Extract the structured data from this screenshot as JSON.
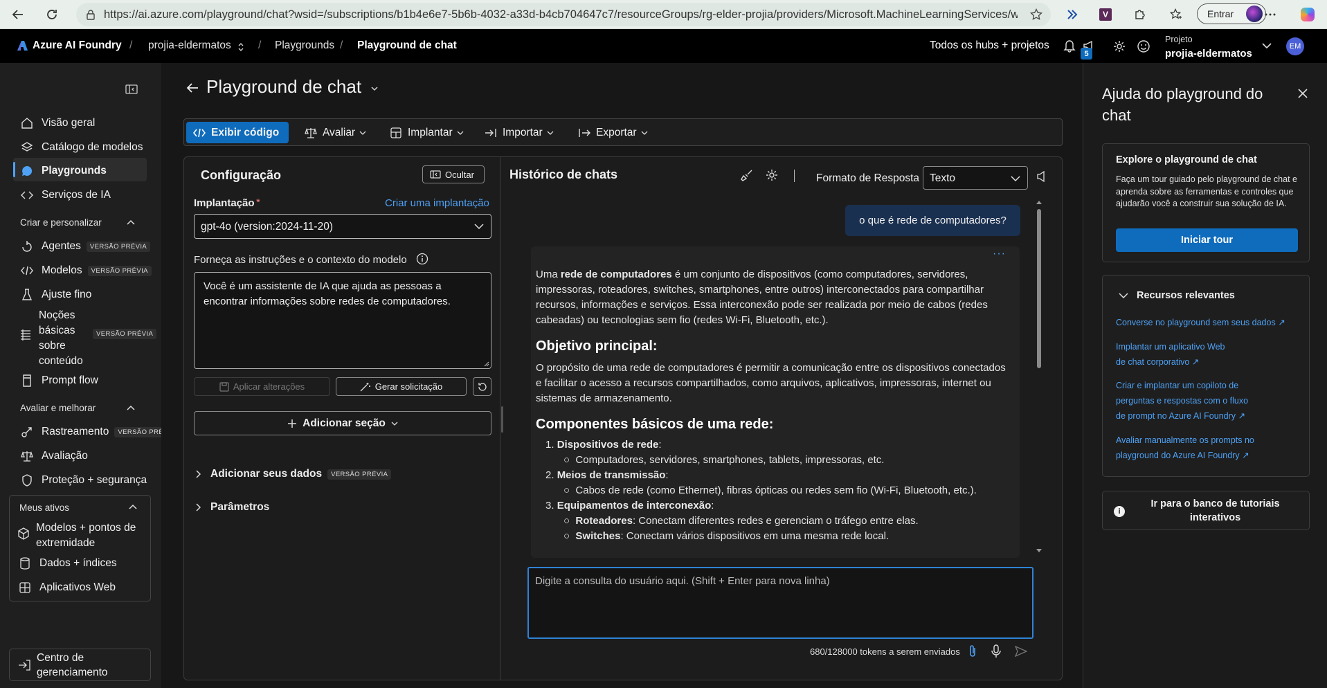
{
  "browser": {
    "url": "https://ai.azure.com/playground/chat?wsid=/subscriptions/b1b4e6e7-5b6b-4032-a33d-b4cb704647c7/resourceGroups/rg-elder-projia/providers/Microsoft.MachineLearningServices/workspa...",
    "signin_label": "Entrar"
  },
  "topbar": {
    "brand": "Azure AI Foundry",
    "project_crumb": "projia-eldermatos",
    "crumb_playgrounds": "Playgrounds",
    "crumb_current": "Playground de chat",
    "hubs_link": "Todos os hubs + projetos",
    "notification_count": "5",
    "project_label": "Projeto",
    "project_name": "projia-eldermatos",
    "avatar_initials": "EM"
  },
  "sidebar": {
    "items_top": [
      {
        "label": "Visão geral",
        "icon": "home-icon"
      },
      {
        "label": "Catálogo de modelos",
        "icon": "catalog-icon"
      },
      {
        "label": "Playgrounds",
        "icon": "chat-icon",
        "active": true
      },
      {
        "label": "Serviços de IA",
        "icon": "ai-services-icon"
      }
    ],
    "group_create": "Criar e personalizar",
    "items_create": [
      {
        "label": "Agentes",
        "badge": "VERSÃO PRÉVIA"
      },
      {
        "label": "Modelos",
        "badge": "VERSÃO PRÉVIA"
      },
      {
        "label": "Ajuste fino"
      },
      {
        "label": "Noções básicas sobre conteúdo",
        "badge": "VERSÃO PRÉVIA"
      },
      {
        "label": "Prompt flow"
      }
    ],
    "group_evaluate": "Avaliar e melhorar",
    "items_evaluate": [
      {
        "label": "Rastreamento",
        "badge": "VERSÃO PRÉ"
      },
      {
        "label": "Avaliação"
      },
      {
        "label": "Proteção + segurança"
      }
    ],
    "group_assets": "Meus ativos",
    "items_assets": [
      {
        "label": "Modelos + pontos de extremidade"
      },
      {
        "label": "Dados + índices"
      },
      {
        "label": "Aplicativos Web"
      }
    ],
    "management": "Centro de gerenciamento"
  },
  "page": {
    "title": "Playground de chat"
  },
  "toolbar": {
    "view_code": "Exibir código",
    "evaluate": "Avaliar",
    "deploy": "Implantar",
    "import": "Importar",
    "export": "Exportar"
  },
  "config": {
    "title": "Configuração",
    "hide": "Ocultar",
    "deployment_label": "Implantação",
    "required_mark": "*",
    "create_deployment": "Criar uma implantação",
    "deployment_value": "gpt-4o (version:2024-11-20)",
    "instructions_label": "Forneça as instruções e o contexto do modelo",
    "system_message": "Você é um assistente de IA que ajuda as pessoas a encontrar informações sobre redes de computadores.",
    "apply_changes": "Aplicar alterações",
    "generate_prompt": "Gerar solicitação",
    "add_section": "Adicionar seção",
    "add_data": "Adicionar seus dados",
    "add_data_badge": "VERSÃO PRÉVIA",
    "parameters": "Parâmetros"
  },
  "chat": {
    "title": "Histórico de chats",
    "response_format_label": "Formato de Resposta",
    "response_format_value": "Texto",
    "user_message": "o que é rede de computadores?",
    "answer_intro_before": "Uma ",
    "answer_intro_bold": "rede de computadores",
    "answer_intro_after": " é um conjunto de dispositivos (como computadores, servidores, impressoras, roteadores, switches, smartphones, entre outros) interconectados para compartilhar recursos, informações e serviços. Essa interconexão pode ser realizada por meio de cabos (redes cabeadas) ou tecnologias sem fio (redes Wi-Fi, Bluetooth, etc.).",
    "h_objective": "Objetivo principal:",
    "objective_text": "O propósito de uma rede de computadores é permitir a comunicação entre os dispositivos conectados e facilitar o acesso a recursos compartilhados, como arquivos, aplicativos, impressoras, internet ou sistemas de armazenamento.",
    "h_components": "Componentes básicos de uma rede:",
    "list": [
      {
        "num": "1.",
        "title": "Dispositivos de rede",
        "subs": [
          {
            "bold": "",
            "text": "Computadores, servidores, smartphones, tablets, impressoras, etc."
          }
        ]
      },
      {
        "num": "2.",
        "title": "Meios de transmissão",
        "subs": [
          {
            "bold": "",
            "text": "Cabos de rede (como Ethernet), fibras ópticas ou redes sem fio (Wi-Fi, Bluetooth, etc.)."
          }
        ]
      },
      {
        "num": "3.",
        "title": "Equipamentos de interconexão",
        "subs": [
          {
            "bold": "Roteadores",
            "text": ": Conectam diferentes redes e gerenciam o tráfego entre elas."
          },
          {
            "bold": "Switches",
            "text": ": Conectam vários dispositivos em uma mesma rede local."
          }
        ]
      }
    ],
    "input_placeholder": "Digite a consulta do usuário aqui. (Shift + Enter para nova linha)",
    "token_count": "680/128000 tokens a serem enviados"
  },
  "help": {
    "title": "Ajuda do playground do chat",
    "tour_title": "Explore o playground de chat",
    "tour_desc": "Faça um tour guiado pelo playground de chat e aprenda sobre as ferramentas e controles que ajudarão você a construir sua solução de IA.",
    "tour_button": "Iniciar tour",
    "resources_title": "Recursos relevantes",
    "resource_links": [
      "Converse no playground sem seus dados",
      "Implantar um aplicativo Web de chat corporativo",
      "Criar e implantar um copiloto de perguntas e respostas com o fluxo de prompt no Azure AI Foundry",
      "Avaliar manualmente os prompts no playground do Azure AI Foundry"
    ],
    "tutorials": "Ir para o banco de tutoriais interativos"
  },
  "colors": {
    "accent": "#0f6cbd",
    "link": "#4ea1f5",
    "active_nav": "#2d2d2d"
  }
}
